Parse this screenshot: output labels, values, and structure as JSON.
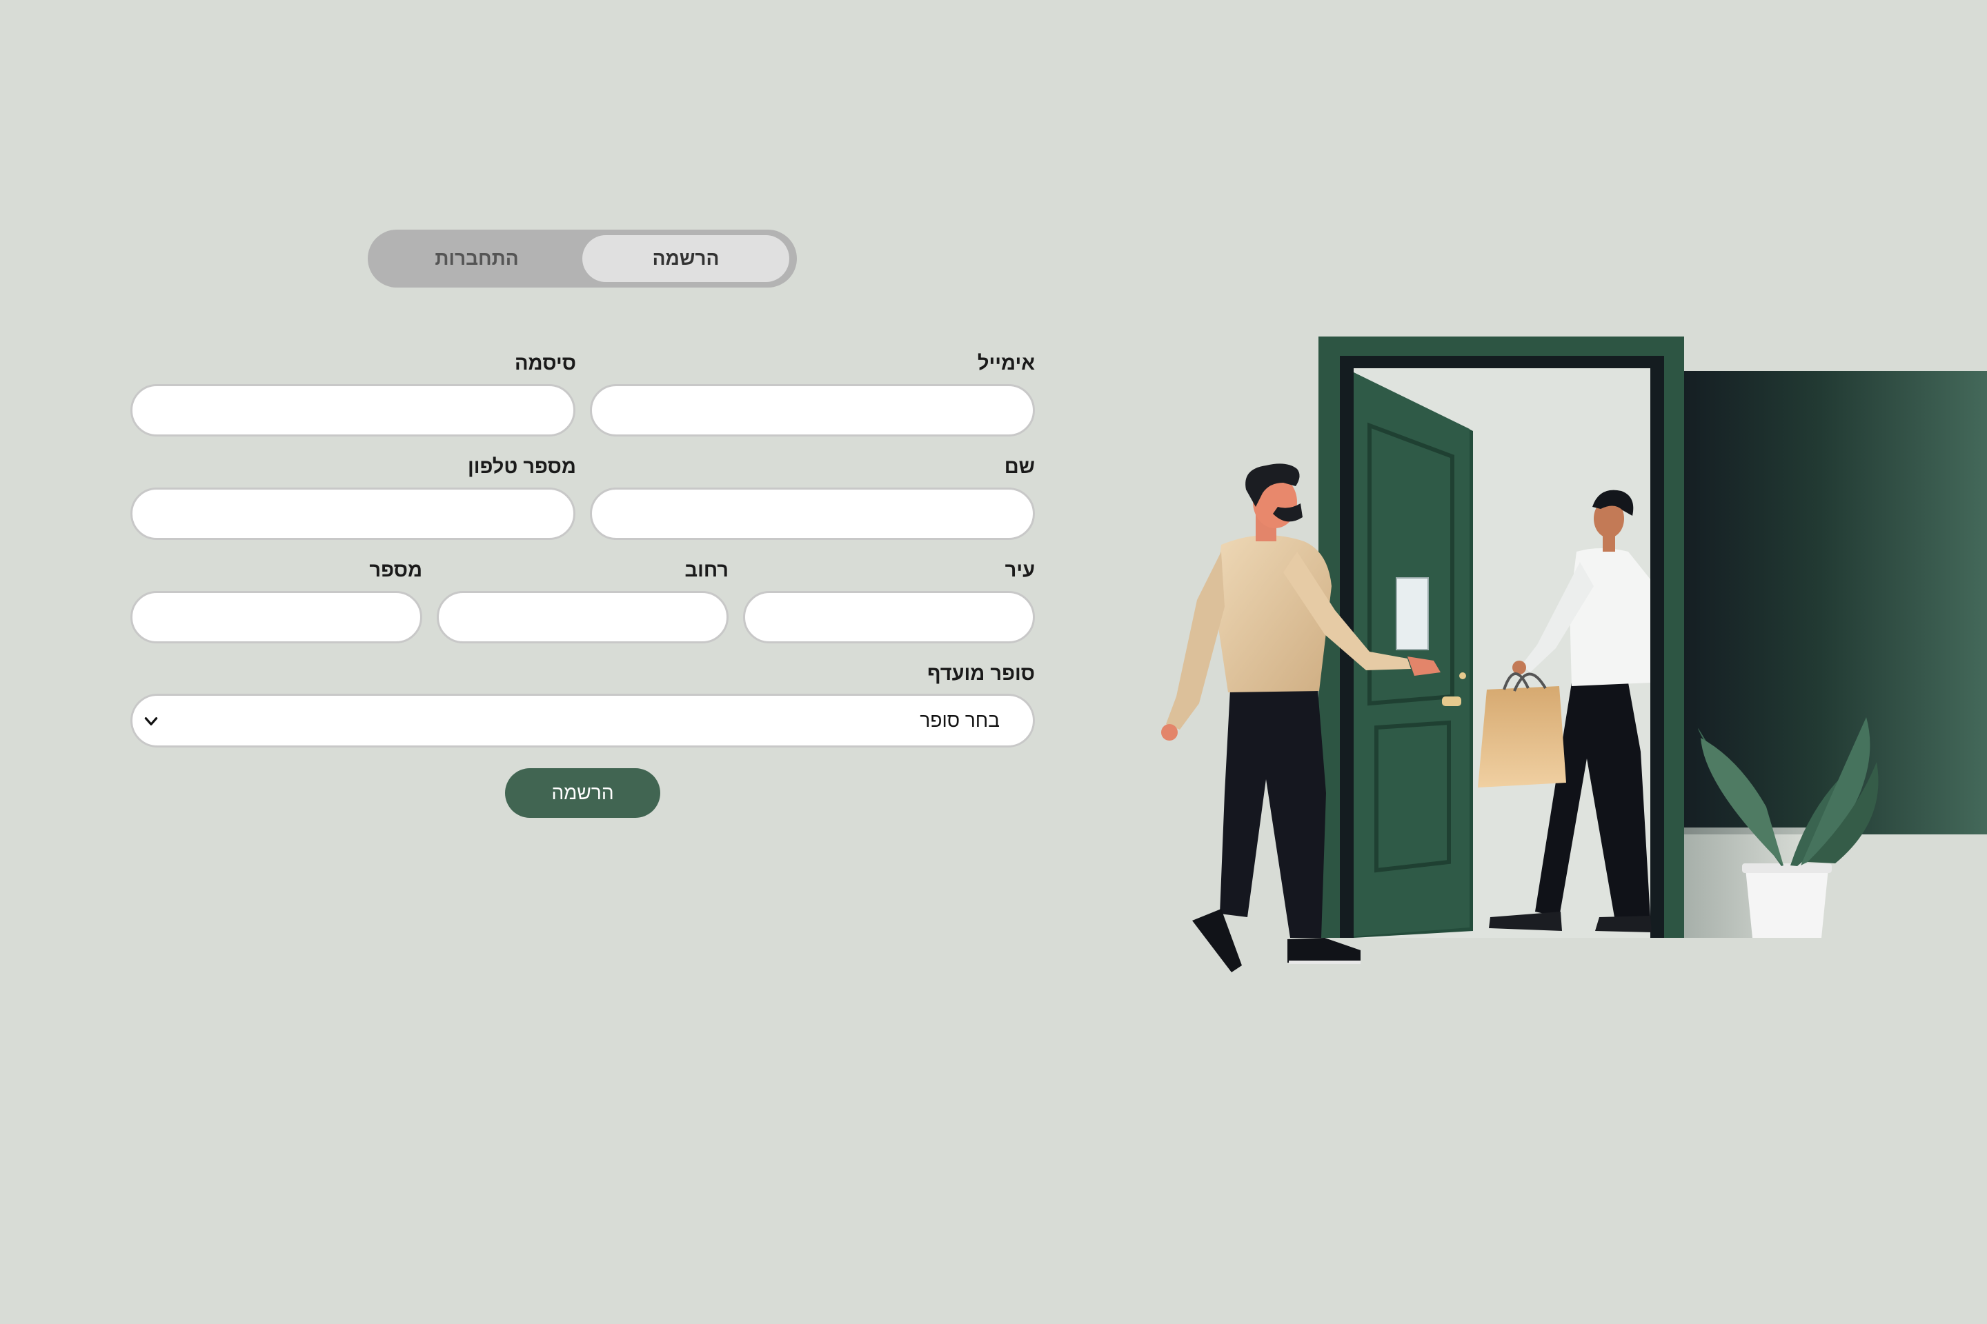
{
  "tabs": {
    "register": "הרשמה",
    "login": "התחברות"
  },
  "fields": {
    "email": {
      "label": "אימייל",
      "value": "",
      "placeholder": ""
    },
    "password": {
      "label": "סיסמה",
      "value": "",
      "placeholder": ""
    },
    "name": {
      "label": "שם",
      "value": "",
      "placeholder": ""
    },
    "phone": {
      "label": "מספר טלפון",
      "value": "",
      "placeholder": ""
    },
    "city": {
      "label": "עיר",
      "value": "",
      "placeholder": ""
    },
    "street": {
      "label": "רחוב",
      "value": "",
      "placeholder": ""
    },
    "number": {
      "label": "מספר",
      "value": "",
      "placeholder": ""
    }
  },
  "writer": {
    "label": "סופר מועדף",
    "selected": "בחר סופר"
  },
  "submit_label": "הרשמה",
  "colors": {
    "background": "#d8dcd6",
    "accent": "#416552",
    "door": "#2d5543"
  }
}
